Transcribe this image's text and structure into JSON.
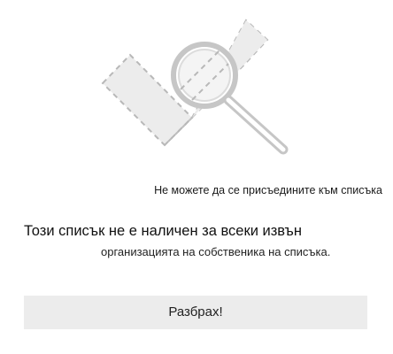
{
  "dialog": {
    "subtitle": "Не можете да се присъедините към списъка",
    "message_line1": "Този списък не е наличен за всеки извън",
    "message_line2": "организацията на собственика на списъка.",
    "button_label": "Разбрах!"
  },
  "illustration": {
    "icon": "magnifier-over-missing-item-icon",
    "dashed_color": "#b8b8b8",
    "fill_color": "#ececec",
    "lens_color": "#c6c6c6"
  }
}
